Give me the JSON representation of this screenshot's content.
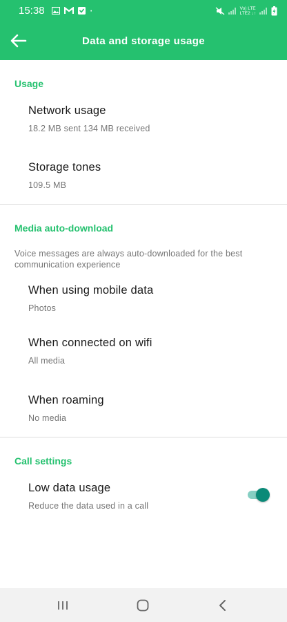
{
  "status_bar": {
    "time": "15:38",
    "notification_icons": [
      "gallery-icon",
      "gmail-icon",
      "download-icon",
      "dot-icon"
    ],
    "dot": "·",
    "network_top": "Vo) LTE",
    "network_bottom": "LTE2 ↓↑",
    "colors": {
      "background": "#25c16f",
      "foreground": "#ffffff"
    }
  },
  "app_bar": {
    "title": "Data and storage usage",
    "back_icon": "arrow-back-icon"
  },
  "sections": {
    "usage": {
      "header": "Usage",
      "network_usage": {
        "title": "Network usage",
        "subtitle": "18.2 MB sent 134 MB received"
      },
      "storage": {
        "title": "Storage tones",
        "subtitle": "109.5 MB"
      }
    },
    "media": {
      "header": "Media auto-download",
      "note": "Voice messages are always auto-downloaded for the best communication experience",
      "mobile_data": {
        "title": "When using mobile data",
        "subtitle": "Photos"
      },
      "wifi": {
        "title": "When connected on wifi",
        "subtitle": "All media"
      },
      "roaming": {
        "title": "When roaming",
        "subtitle": "No media"
      }
    },
    "call": {
      "header": "Call settings",
      "low_data": {
        "title": "Low data usage",
        "subtitle": "Reduce the data used in a call",
        "enabled": true
      }
    }
  },
  "nav_bar": {
    "recent_icon": "recent-apps-icon",
    "home_icon": "home-icon",
    "back_icon": "back-chevron-icon"
  },
  "colors": {
    "accent": "#25c16f",
    "toggle_on": "#0a8a78",
    "secondary_text": "#757575",
    "divider": "#dcdcdc"
  }
}
